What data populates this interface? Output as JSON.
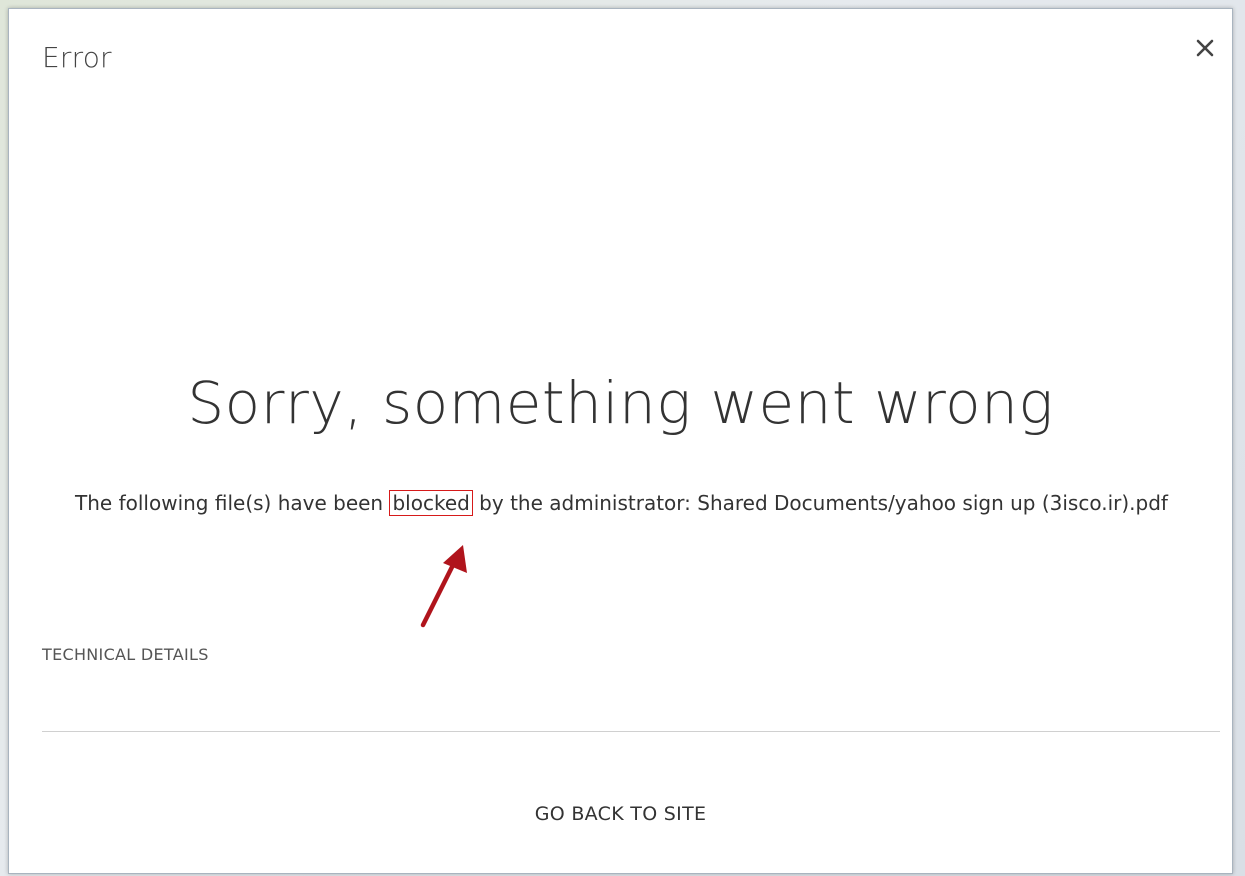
{
  "dialog": {
    "title": "Error",
    "close_icon": "close-icon"
  },
  "main": {
    "headline": "Sorry, something went wrong",
    "message_before": "The following file(s) have been ",
    "message_highlight": "blocked",
    "message_after": " by the administrator: Shared Documents/yahoo sign up (3isco.ir).pdf",
    "technical_details_label": "TECHNICAL DETAILS",
    "go_back_label": "GO BACK TO SITE"
  },
  "annotation": {
    "highlight_color": "#d61a1a",
    "arrow_color": "#b0141c",
    "arrow_icon": "arrow-up-right-icon"
  }
}
